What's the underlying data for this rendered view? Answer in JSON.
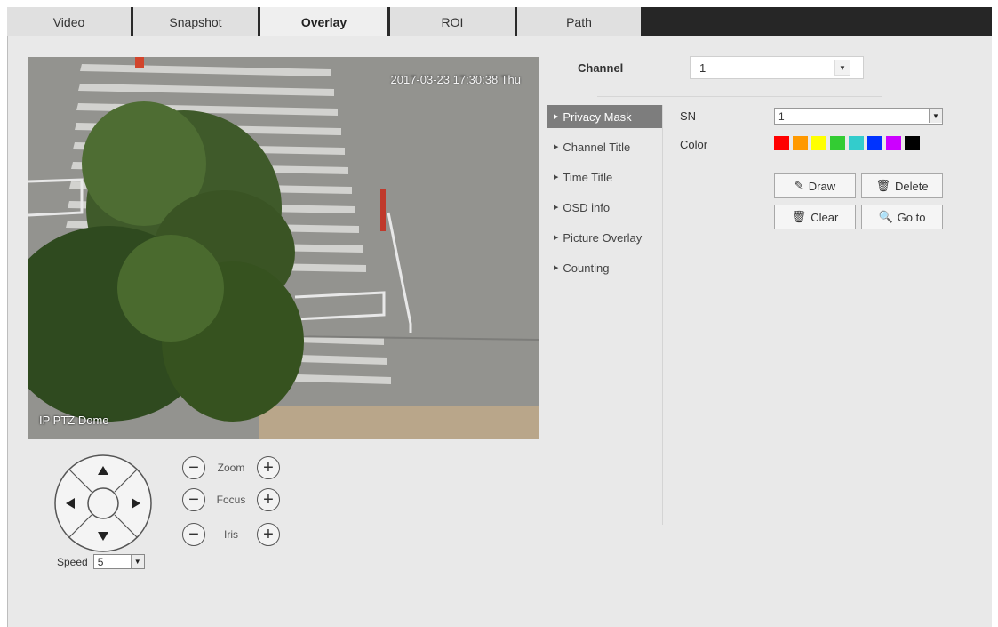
{
  "tabs": [
    {
      "label": "Video",
      "active": false
    },
    {
      "label": "Snapshot",
      "active": false
    },
    {
      "label": "Overlay",
      "active": true
    },
    {
      "label": "ROI",
      "active": false
    },
    {
      "label": "Path",
      "active": false
    }
  ],
  "video": {
    "timestamp": "2017-03-23 17:30:38 Thu",
    "camera_title": "IP PTZ Dome"
  },
  "ptz": {
    "zoom_label": "Zoom",
    "focus_label": "Focus",
    "iris_label": "Iris",
    "minus_glyph": "−",
    "plus_glyph": "+",
    "speed_label": "Speed",
    "speed_value": "5"
  },
  "channel": {
    "label": "Channel",
    "value": "1"
  },
  "submenu": [
    {
      "label": "Privacy Mask",
      "active": true
    },
    {
      "label": "Channel Title",
      "active": false
    },
    {
      "label": "Time Title",
      "active": false
    },
    {
      "label": "OSD info",
      "active": false
    },
    {
      "label": "Picture Overlay",
      "active": false
    },
    {
      "label": "Counting",
      "active": false
    }
  ],
  "privacy_mask": {
    "sn_label": "SN",
    "sn_value": "1",
    "color_label": "Color",
    "colors": [
      "#ff0000",
      "#ff9900",
      "#ffff00",
      "#33cc33",
      "#33cccc",
      "#0033ff",
      "#cc00ff",
      "#000000"
    ],
    "draw_label": "Draw",
    "delete_label": "Delete",
    "clear_label": "Clear",
    "goto_label": "Go to"
  }
}
